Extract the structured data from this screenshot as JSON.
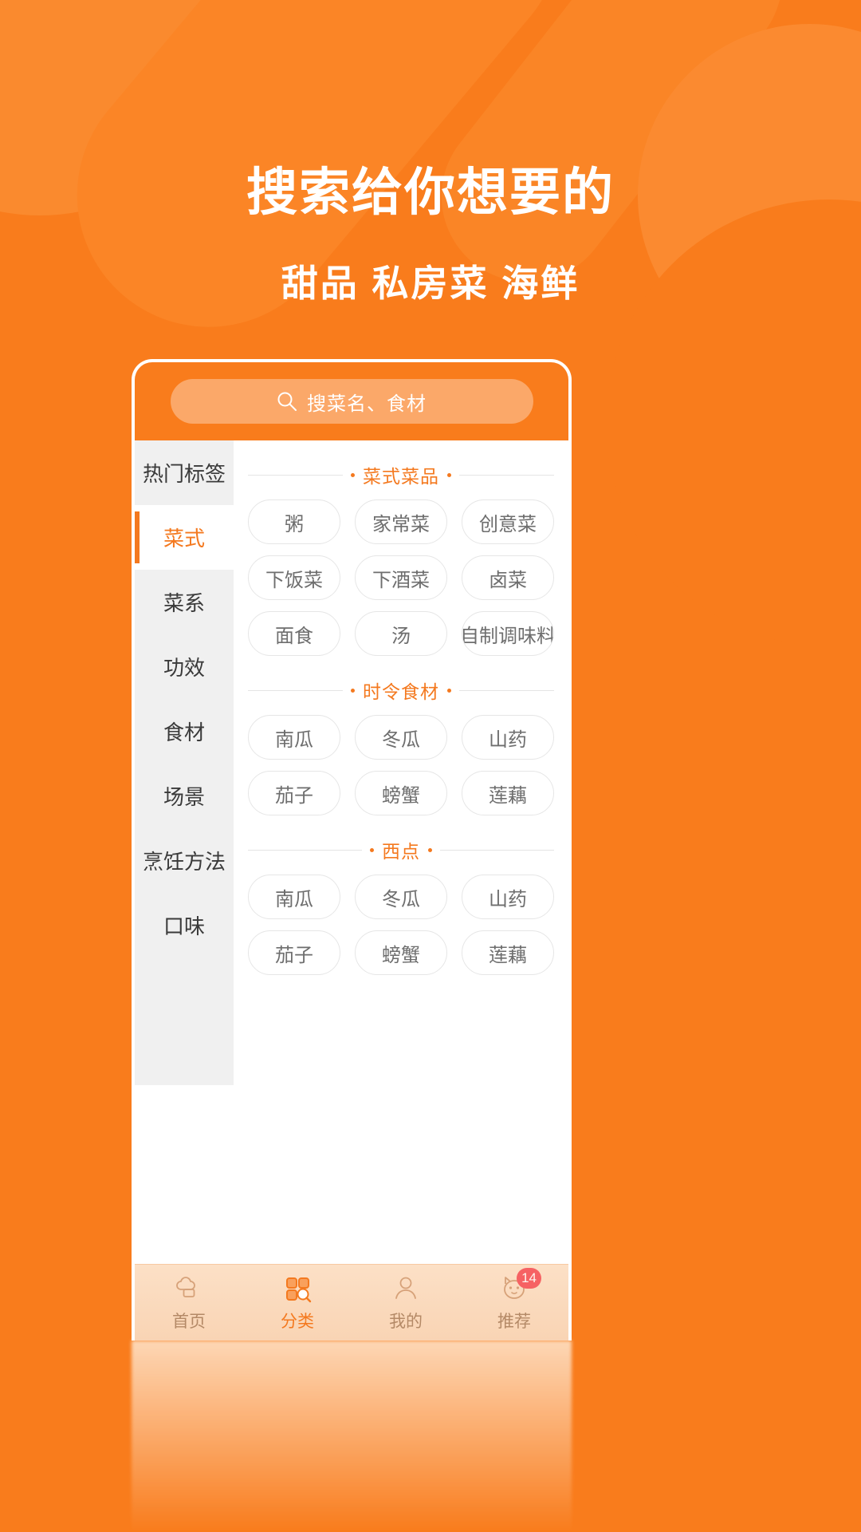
{
  "theme": {
    "brand_orange": "#F97C1C",
    "accent_orange": "#F4791F",
    "badge_red": "#F5333F",
    "sidebar_grey": "#F0F0F0",
    "chip_border": "#E6E6E6"
  },
  "hero": {
    "title": "搜索给你想要的",
    "subtitle": "甜品 私房菜 海鲜"
  },
  "search": {
    "placeholder": "搜菜名、食材",
    "icon": "search-icon",
    "value": ""
  },
  "sidebar": {
    "items": [
      {
        "label": "热门标签",
        "active": false
      },
      {
        "label": "菜式",
        "active": true
      },
      {
        "label": "菜系",
        "active": false
      },
      {
        "label": "功效",
        "active": false
      },
      {
        "label": "食材",
        "active": false
      },
      {
        "label": "场景",
        "active": false
      },
      {
        "label": "烹饪方法",
        "active": false
      },
      {
        "label": "口味",
        "active": false
      }
    ]
  },
  "content": {
    "sections": [
      {
        "title": "菜式菜品",
        "rows": [
          [
            "粥",
            "家常菜",
            "创意菜"
          ],
          [
            "下饭菜",
            "下酒菜",
            "卤菜"
          ],
          [
            "面食",
            "汤",
            "自制调味料"
          ]
        ]
      },
      {
        "title": "时令食材",
        "rows": [
          [
            "南瓜",
            "冬瓜",
            "山药"
          ],
          [
            "茄子",
            "螃蟹",
            "莲藕"
          ]
        ]
      },
      {
        "title": "西点",
        "rows": [
          [
            "南瓜",
            "冬瓜",
            "山药"
          ],
          [
            "茄子",
            "螃蟹",
            "莲藕"
          ]
        ]
      }
    ]
  },
  "tabbar": {
    "items": [
      {
        "label": "首页",
        "icon": "chef-hat-icon",
        "active": false,
        "badge": ""
      },
      {
        "label": "分类",
        "icon": "grid-search-icon",
        "active": true,
        "badge": ""
      },
      {
        "label": "我的",
        "icon": "person-icon",
        "active": false,
        "badge": ""
      },
      {
        "label": "推荐",
        "icon": "cat-face-icon",
        "active": false,
        "badge": "14"
      }
    ]
  }
}
